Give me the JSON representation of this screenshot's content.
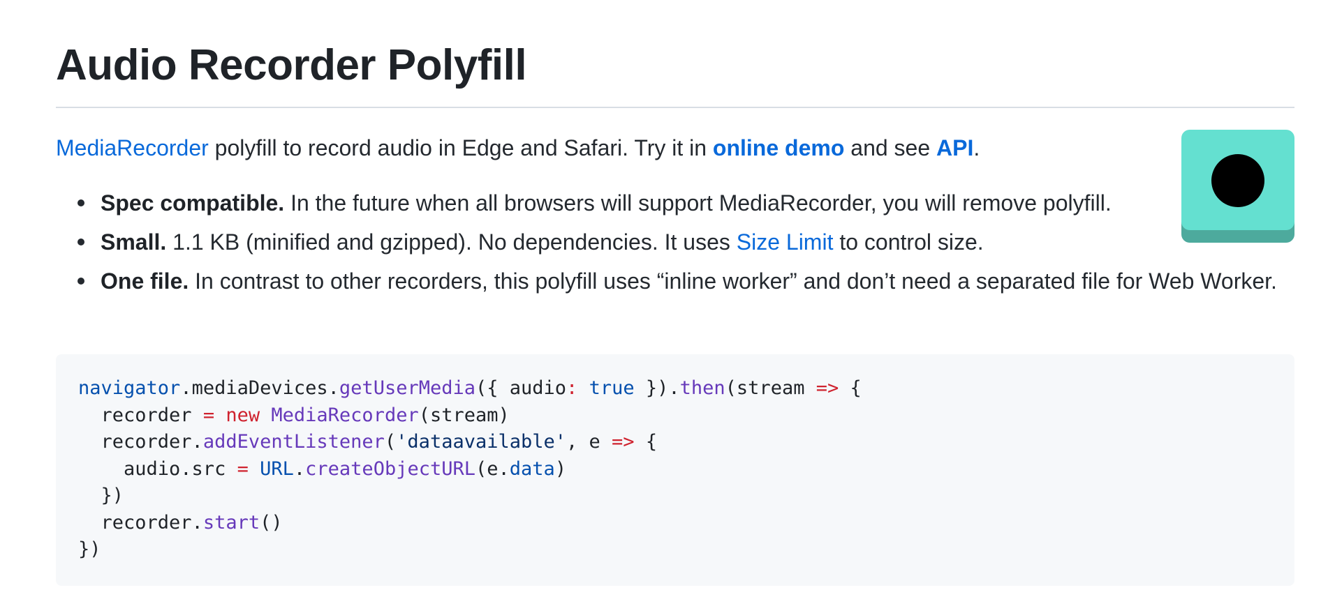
{
  "heading": "Audio Recorder Polyfill",
  "intro": {
    "link_mediarecorder": "MediaRecorder",
    "text_1": " polyfill to record audio in Edge and Safari. Try it in ",
    "link_demo": "online demo",
    "text_2": " and see ",
    "link_api": "API",
    "text_3": "."
  },
  "features": [
    {
      "lead": "Spec compatible.",
      "text": " In the future when all browsers will support MediaRecorder, you will remove polyfill."
    },
    {
      "lead": "Small.",
      "text_1": " 1.1 KB (minified and gzipped). No dependencies. It uses ",
      "link": "Size Limit",
      "text_2": " to control size."
    },
    {
      "lead": "One file.",
      "text": " In contrast to other recorders, this polyfill uses “inline worker” and don’t need a separated file for Web Worker."
    }
  ],
  "logo": {
    "icon": "record-button-icon",
    "colors": {
      "face": "#64e0d0",
      "shadow": "#4daa9d",
      "dot": "#000000"
    }
  },
  "code": {
    "language": "javascript",
    "lines": [
      [
        [
          "obj",
          "navigator"
        ],
        [
          "p",
          "."
        ],
        [
          "p",
          "mediaDevices"
        ],
        [
          "p",
          "."
        ],
        [
          "fn",
          "getUserMedia"
        ],
        [
          "p",
          "({ audio"
        ],
        [
          "kw",
          ":"
        ],
        [
          "p",
          " "
        ],
        [
          "bool",
          "true"
        ],
        [
          "p",
          " })."
        ],
        [
          "fn",
          "then"
        ],
        [
          "p",
          "(stream "
        ],
        [
          "kw",
          "=>"
        ],
        [
          "p",
          " {"
        ]
      ],
      [
        [
          "p",
          "  recorder "
        ],
        [
          "kw",
          "="
        ],
        [
          "p",
          " "
        ],
        [
          "kw",
          "new"
        ],
        [
          "p",
          " "
        ],
        [
          "cls",
          "MediaRecorder"
        ],
        [
          "p",
          "(stream)"
        ]
      ],
      [
        [
          "p",
          "  recorder."
        ],
        [
          "fn",
          "addEventListener"
        ],
        [
          "p",
          "("
        ],
        [
          "str",
          "'dataavailable'"
        ],
        [
          "p",
          ", e "
        ],
        [
          "kw",
          "=>"
        ],
        [
          "p",
          " {"
        ]
      ],
      [
        [
          "p",
          "    audio.src "
        ],
        [
          "kw",
          "="
        ],
        [
          "p",
          " "
        ],
        [
          "obj",
          "URL"
        ],
        [
          "p",
          "."
        ],
        [
          "fn",
          "createObjectURL"
        ],
        [
          "p",
          "(e."
        ],
        [
          "prop",
          "data"
        ],
        [
          "p",
          ")"
        ]
      ],
      [
        [
          "p",
          "  })"
        ]
      ],
      [
        [
          "p",
          "  recorder."
        ],
        [
          "fn",
          "start"
        ],
        [
          "p",
          "()"
        ]
      ],
      [
        [
          "p",
          "})"
        ]
      ]
    ]
  }
}
